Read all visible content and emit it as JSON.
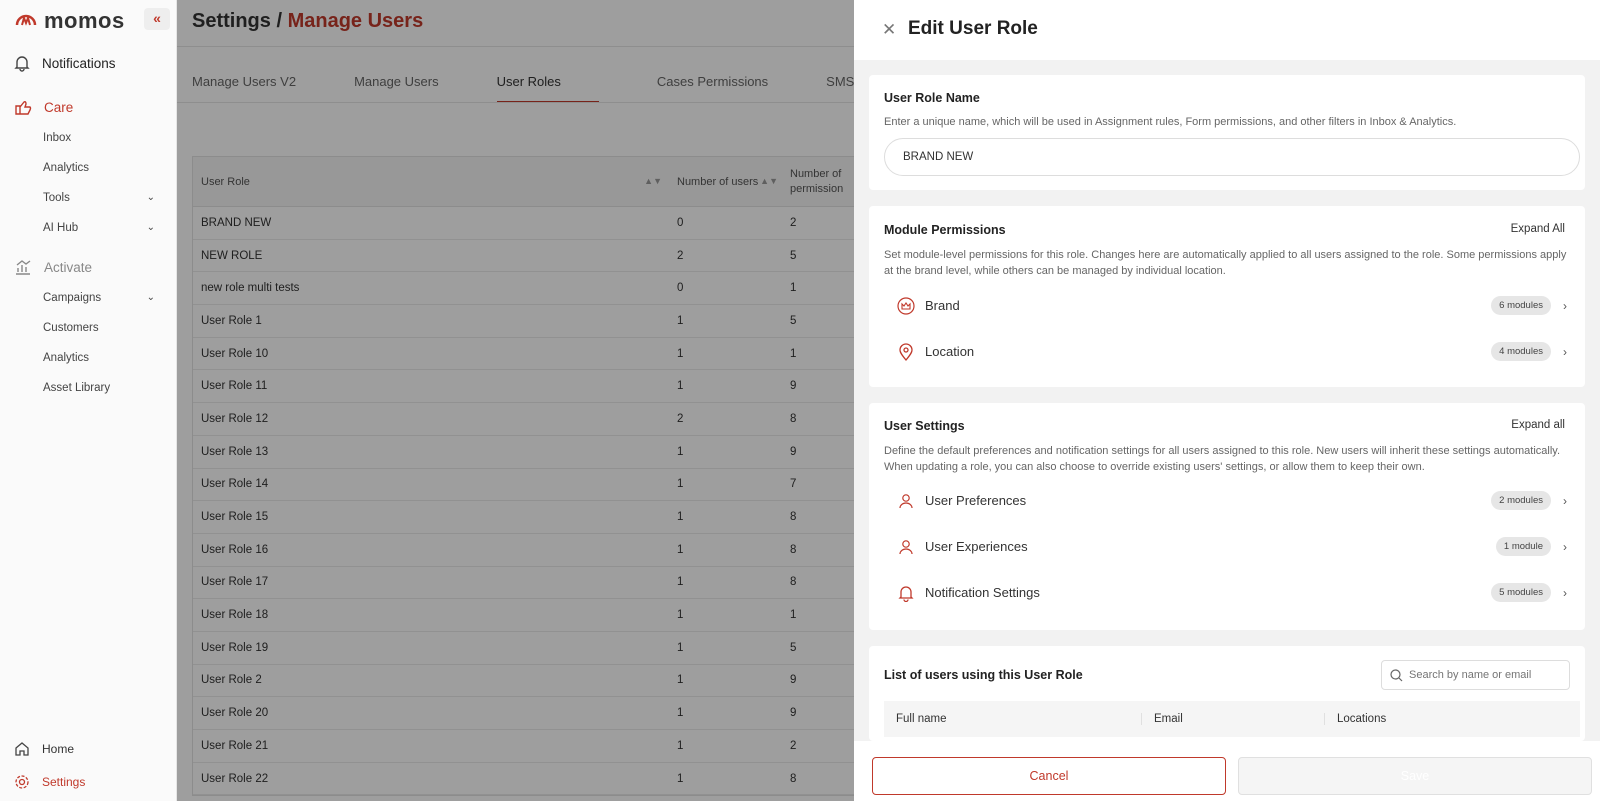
{
  "sidebar": {
    "brand": "momos",
    "collapse_label": "«",
    "notifications": "Notifications",
    "care": {
      "label": "Care",
      "items": [
        {
          "label": "Inbox"
        },
        {
          "label": "Analytics"
        },
        {
          "label": "Tools"
        },
        {
          "label": "AI Hub"
        }
      ]
    },
    "activate": {
      "label": "Activate",
      "items": [
        {
          "label": "Campaigns"
        },
        {
          "label": "Customers"
        },
        {
          "label": "Analytics"
        },
        {
          "label": "Asset Library"
        }
      ]
    },
    "home": "Home",
    "settings": "Settings"
  },
  "header": {
    "title_prefix": "Settings /",
    "title_accent": "Manage Users"
  },
  "tabs": [
    {
      "label": "Manage Users V2"
    },
    {
      "label": "Manage Users"
    },
    {
      "label": "User Roles",
      "active": true
    },
    {
      "label": "Cases Permissions"
    },
    {
      "label": "SMS"
    }
  ],
  "table": {
    "columns": [
      "User Role",
      "Number of users",
      "Number of permission"
    ],
    "rows": [
      [
        "BRAND NEW",
        "0",
        "2"
      ],
      [
        "NEW ROLE",
        "2",
        "5"
      ],
      [
        "new role multi tests",
        "0",
        "1"
      ],
      [
        "User Role 1",
        "1",
        "5"
      ],
      [
        "User Role 10",
        "1",
        "1"
      ],
      [
        "User Role 11",
        "1",
        "9"
      ],
      [
        "User Role 12",
        "2",
        "8"
      ],
      [
        "User Role 13",
        "1",
        "9"
      ],
      [
        "User Role 14",
        "1",
        "7"
      ],
      [
        "User Role 15",
        "1",
        "8"
      ],
      [
        "User Role 16",
        "1",
        "8"
      ],
      [
        "User Role 17",
        "1",
        "8"
      ],
      [
        "User Role 18",
        "1",
        "1"
      ],
      [
        "User Role 19",
        "1",
        "5"
      ],
      [
        "User Role 2",
        "1",
        "9"
      ],
      [
        "User Role 20",
        "1",
        "9"
      ],
      [
        "User Role 21",
        "1",
        "2"
      ],
      [
        "User Role 22",
        "1",
        "8"
      ]
    ]
  },
  "drawer": {
    "title": "Edit User Role",
    "role_name": {
      "heading": "User Role Name",
      "desc": "Enter a unique name, which will be used in Assignment rules, Form permissions, and other filters in Inbox & Analytics.",
      "value": "BRAND NEW"
    },
    "module_permissions": {
      "heading": "Module Permissions",
      "expand": "Expand All",
      "desc": "Set module-level permissions for this role. Changes here are automatically applied to all users assigned to the role. Some permissions apply at the brand level, while others can be managed by individual location.",
      "items": [
        {
          "label": "Brand",
          "badge": "6 modules"
        },
        {
          "label": "Location",
          "badge": "4 modules"
        }
      ]
    },
    "user_settings": {
      "heading": "User Settings",
      "expand": "Expand all",
      "desc": "Define the default preferences and notification settings for all users assigned to this role. New users will inherit these settings automatically. When updating a role, you can also choose to override existing users' settings, or allow them to keep their own.",
      "items": [
        {
          "label": "User Preferences",
          "badge": "2 modules"
        },
        {
          "label": "User Experiences",
          "badge": "1 module"
        },
        {
          "label": "Notification Settings",
          "badge": "5 modules"
        }
      ]
    },
    "users_list": {
      "heading": "List of users using this User Role",
      "search_placeholder": "Search by name or email",
      "columns": [
        "Full name",
        "Email",
        "Locations"
      ]
    },
    "cancel": "Cancel",
    "save": "Save"
  },
  "colors": {
    "accent": "#c0392b",
    "overlay": "rgba(0,0,0,0.38)"
  }
}
